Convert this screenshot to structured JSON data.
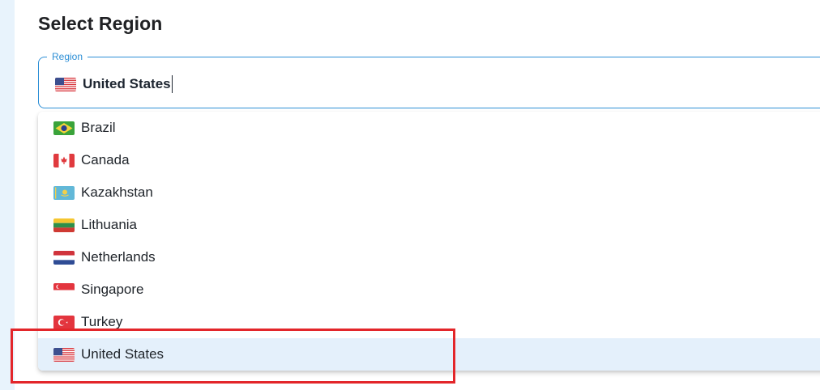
{
  "page": {
    "title": "Select Region"
  },
  "region_field": {
    "legend": "Region",
    "value": "United States",
    "value_flag": "us-flag-icon"
  },
  "dropdown": {
    "options": [
      {
        "label": "Brazil",
        "flag": "brazil-flag-icon"
      },
      {
        "label": "Canada",
        "flag": "canada-flag-icon"
      },
      {
        "label": "Kazakhstan",
        "flag": "kazakhstan-flag-icon"
      },
      {
        "label": "Lithuania",
        "flag": "lithuania-flag-icon"
      },
      {
        "label": "Netherlands",
        "flag": "netherlands-flag-icon"
      },
      {
        "label": "Singapore",
        "flag": "singapore-flag-icon"
      },
      {
        "label": "Turkey",
        "flag": "turkey-flag-icon"
      },
      {
        "label": "United States",
        "flag": "us-flag-icon",
        "selected": true
      }
    ]
  },
  "colors": {
    "accent": "#2d8fd6",
    "selected_row": "#e4f0fb",
    "annotation_box": "#e3262a"
  }
}
